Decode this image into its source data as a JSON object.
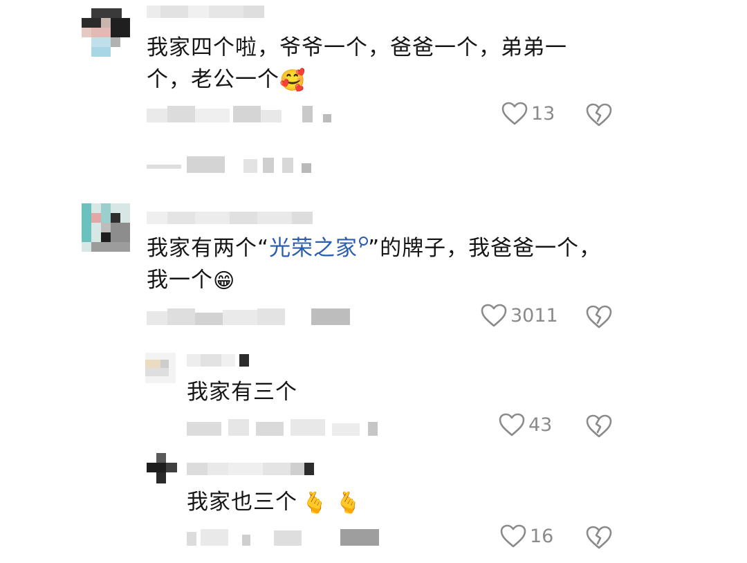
{
  "comments": [
    {
      "text_before": "我家四个啦，爷爷一个，爸爸一个，弟弟一\n个，老公一个",
      "emoji": "🥰",
      "likes": "13"
    },
    {
      "text_before": "我家有两个“",
      "link_text": "光荣之家",
      "text_after": "”的牌子，我爸爸一个，\n我一个",
      "emoji": "😁",
      "likes": "3011"
    }
  ],
  "replies": [
    {
      "text": "我家有三个",
      "likes": "43"
    },
    {
      "text": "我家也三个",
      "emoji": "🫰 🫰",
      "likes": "16"
    }
  ],
  "icons": {
    "like": "heart-outline-icon",
    "dislike": "broken-heart-icon"
  },
  "colors": {
    "link": "#2a5db0",
    "meta": "#8a8a8a",
    "text": "#151515"
  }
}
